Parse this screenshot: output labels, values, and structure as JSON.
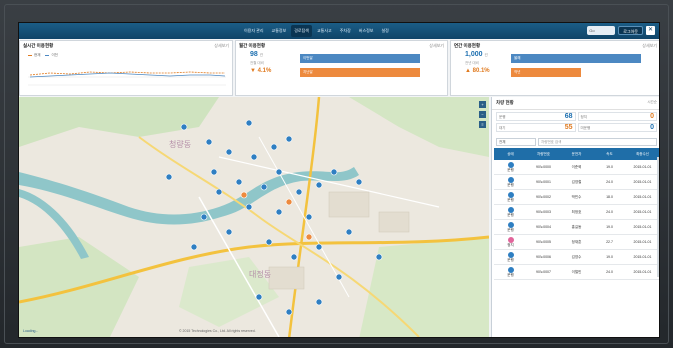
{
  "nav": {
    "items": [
      "이용자 관리",
      "교통정보",
      "경로탐색",
      "교통사고",
      "주차장",
      "버스정보",
      "설정"
    ],
    "active_index": 2
  },
  "topright": {
    "search": "Go",
    "login": "로그아웃",
    "close": "✕"
  },
  "panel1": {
    "title": "실시간 이용현황",
    "link": "상세보기",
    "legend": [
      "현재",
      "이전"
    ]
  },
  "panel2": {
    "title": "월간 이용현황",
    "link": "상세보기",
    "big": "98",
    "big_unit": "건",
    "sub": "전월 대비",
    "delta": "▼ 4.1%",
    "bar_blue": "이번달",
    "bar_orange": "지난달"
  },
  "panel3": {
    "title": "연간 이용현황",
    "link": "상세보기",
    "big": "1,000",
    "big_unit": "건",
    "sub": "전년 대비",
    "delta": "▲ 80.1%",
    "bar_blue": "올해",
    "bar_orange": "작년"
  },
  "map": {
    "copyright": "© 2015 Technologies Co., Ltd. All rights reserved.",
    "logo": "Loading...",
    "area_labels": [
      "청량동",
      "대정동"
    ]
  },
  "right": {
    "title": "차량 현황",
    "sort": "시간순",
    "status": [
      {
        "label": "운행",
        "value": "68",
        "sub": "/ 80"
      },
      {
        "label": "정지",
        "value": "0"
      },
      {
        "label": "대기",
        "value": "55"
      },
      {
        "label": "미운행",
        "value": "0"
      }
    ],
    "filter_select": "전체",
    "filter_placeholder": "차량번호 검색",
    "columns": [
      "상태",
      "차량번호",
      "운전자",
      "속도",
      "최종수신"
    ],
    "rows": [
      {
        "state": "운행",
        "num": "90노0000",
        "driver": "이준혁",
        "speed": "19.0",
        "time": "2015-01-01"
      },
      {
        "state": "운행",
        "num": "90노0001",
        "driver": "김영철",
        "speed": "24.0",
        "time": "2015-01-01"
      },
      {
        "state": "운행",
        "num": "90노0002",
        "driver": "박민수",
        "speed": "18.0",
        "time": "2015-01-01"
      },
      {
        "state": "운행",
        "num": "90노0003",
        "driver": "최정호",
        "speed": "24.0",
        "time": "2015-01-01"
      },
      {
        "state": "운행",
        "num": "90노0004",
        "driver": "홍길동",
        "speed": "19.0",
        "time": "2015-01-01"
      },
      {
        "state": "정지",
        "num": "90노0005",
        "driver": "정재훈",
        "speed": "22.7",
        "time": "2015-01-01"
      },
      {
        "state": "운행",
        "num": "90노0006",
        "driver": "김영수",
        "speed": "19.0",
        "time": "2015-01-01"
      },
      {
        "state": "운행",
        "num": "90노0007",
        "driver": "이철민",
        "speed": "24.0",
        "time": "2015-01-01"
      }
    ]
  }
}
